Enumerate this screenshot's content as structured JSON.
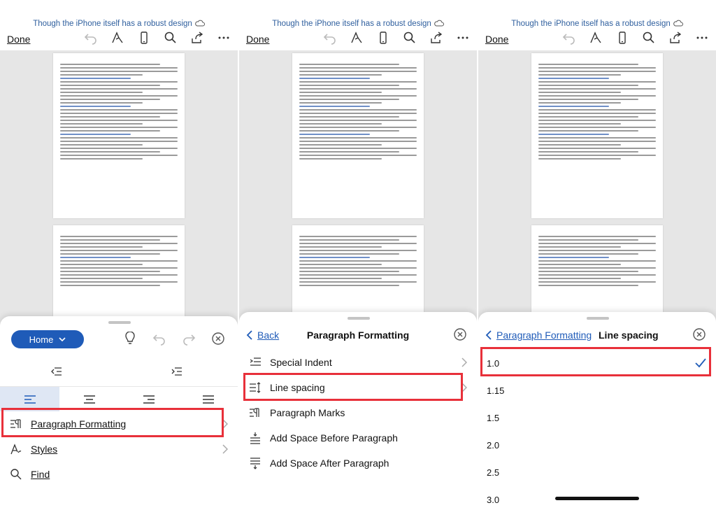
{
  "doc_title": "Though the iPhone itself has a robust design",
  "done_label": "Done",
  "colors": {
    "accent": "#1f5bb8",
    "highlight": "#e8303a",
    "selected_bg": "#dfe7f4"
  },
  "panel1": {
    "home_label": "Home",
    "menu": [
      {
        "label": "Paragraph Formatting",
        "icon": "paragraph-formatting-icon"
      },
      {
        "label": "Styles",
        "icon": "styles-icon"
      },
      {
        "label": "Find",
        "icon": "search-icon"
      }
    ]
  },
  "panel2": {
    "back_label": "Back",
    "title": "Paragraph Formatting",
    "menu": [
      {
        "label": "Special Indent",
        "icon": "special-indent-icon"
      },
      {
        "label": "Line spacing",
        "icon": "line-spacing-icon"
      },
      {
        "label": "Paragraph Marks",
        "icon": "paragraph-marks-icon"
      },
      {
        "label": "Add Space Before Paragraph",
        "icon": "space-before-icon"
      },
      {
        "label": "Add Space After Paragraph",
        "icon": "space-after-icon"
      }
    ]
  },
  "panel3": {
    "back_label": "Paragraph Formatting",
    "title": "Line spacing",
    "options": [
      "1.0",
      "1.15",
      "1.5",
      "2.0",
      "2.5",
      "3.0"
    ],
    "selected": "1.0"
  }
}
